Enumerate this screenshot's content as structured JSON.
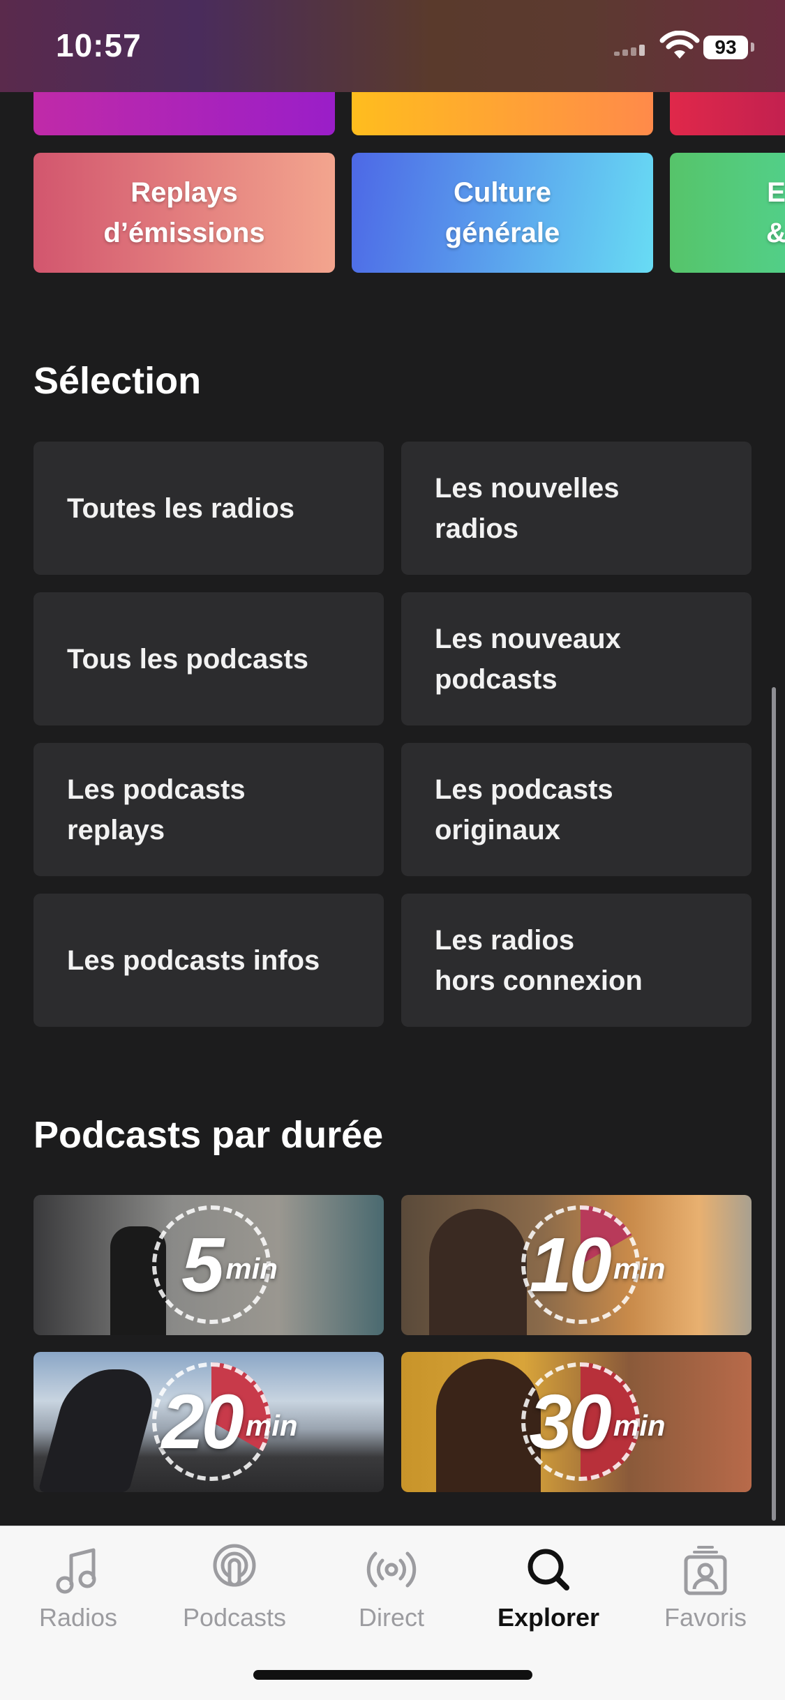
{
  "status_bar": {
    "time": "10:57",
    "battery": "93"
  },
  "categories_top_colors": [
    "#a920c0",
    "#ff9a2a",
    "#d8284a"
  ],
  "categories": [
    {
      "label": "Replays\nd’émissions",
      "gradient": [
        "#d4546e",
        "#f3a590"
      ]
    },
    {
      "label": "Culture\ngénérale",
      "gradient": [
        "#4f6fe8",
        "#66d4f2"
      ]
    },
    {
      "label": "E\n&",
      "gradient": [
        "#5bc86e",
        "#4fd08a"
      ]
    }
  ],
  "selection": {
    "title": "Sélection",
    "items": [
      "Toutes les radios",
      "Les nouvelles\nradios",
      "Tous les podcasts",
      "Les nouveaux\npodcasts",
      "Les podcasts\nreplays",
      "Les podcasts\noriginaux",
      "Les podcasts infos",
      "Les radios\nhors connexion"
    ]
  },
  "durations": {
    "title": "Podcasts par durée",
    "items": [
      {
        "value": "5",
        "unit": "min"
      },
      {
        "value": "10",
        "unit": "min"
      },
      {
        "value": "20",
        "unit": "min"
      },
      {
        "value": "30",
        "unit": "min"
      }
    ]
  },
  "tabs": [
    {
      "label": "Radios",
      "icon": "music-note-icon",
      "active": false
    },
    {
      "label": "Podcasts",
      "icon": "podcast-icon",
      "active": false
    },
    {
      "label": "Direct",
      "icon": "broadcast-icon",
      "active": false
    },
    {
      "label": "Explorer",
      "icon": "search-icon",
      "active": true
    },
    {
      "label": "Favoris",
      "icon": "profile-icon",
      "active": false
    }
  ],
  "colors": {
    "background": "#1c1c1d",
    "card": "#2c2c2e",
    "accent_wedge": "#b83a5a"
  }
}
